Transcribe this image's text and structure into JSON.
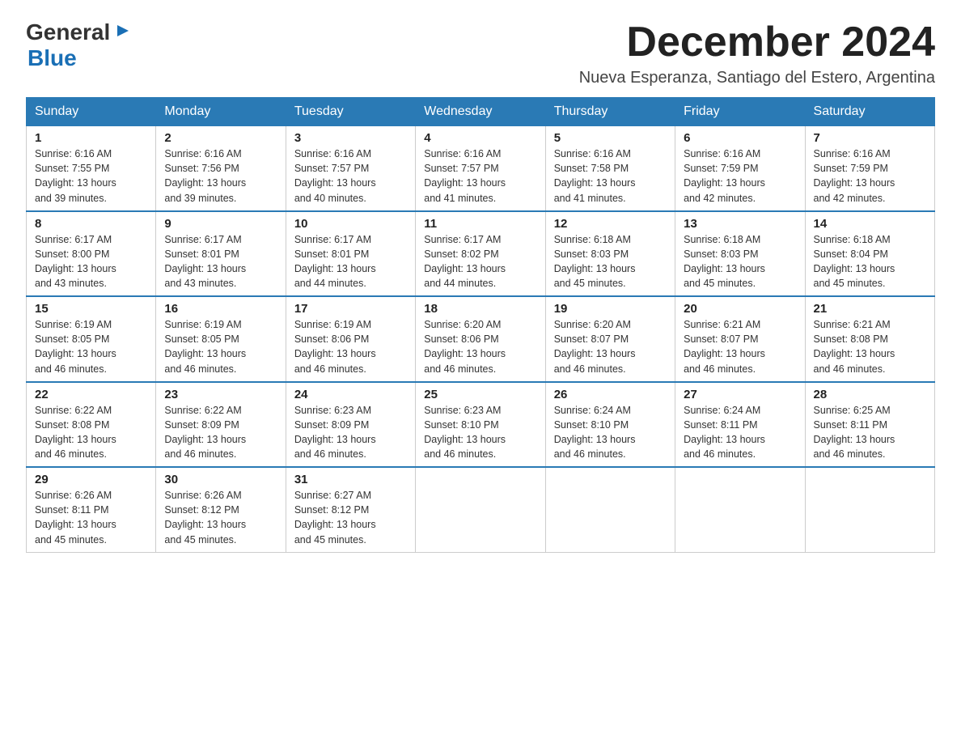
{
  "header": {
    "logo_general": "General",
    "logo_blue": "Blue",
    "month_title": "December 2024",
    "location": "Nueva Esperanza, Santiago del Estero, Argentina"
  },
  "weekdays": [
    "Sunday",
    "Monday",
    "Tuesday",
    "Wednesday",
    "Thursday",
    "Friday",
    "Saturday"
  ],
  "weeks": [
    [
      {
        "day": "1",
        "sunrise": "6:16 AM",
        "sunset": "7:55 PM",
        "daylight": "13 hours and 39 minutes."
      },
      {
        "day": "2",
        "sunrise": "6:16 AM",
        "sunset": "7:56 PM",
        "daylight": "13 hours and 39 minutes."
      },
      {
        "day": "3",
        "sunrise": "6:16 AM",
        "sunset": "7:57 PM",
        "daylight": "13 hours and 40 minutes."
      },
      {
        "day": "4",
        "sunrise": "6:16 AM",
        "sunset": "7:57 PM",
        "daylight": "13 hours and 41 minutes."
      },
      {
        "day": "5",
        "sunrise": "6:16 AM",
        "sunset": "7:58 PM",
        "daylight": "13 hours and 41 minutes."
      },
      {
        "day": "6",
        "sunrise": "6:16 AM",
        "sunset": "7:59 PM",
        "daylight": "13 hours and 42 minutes."
      },
      {
        "day": "7",
        "sunrise": "6:16 AM",
        "sunset": "7:59 PM",
        "daylight": "13 hours and 42 minutes."
      }
    ],
    [
      {
        "day": "8",
        "sunrise": "6:17 AM",
        "sunset": "8:00 PM",
        "daylight": "13 hours and 43 minutes."
      },
      {
        "day": "9",
        "sunrise": "6:17 AM",
        "sunset": "8:01 PM",
        "daylight": "13 hours and 43 minutes."
      },
      {
        "day": "10",
        "sunrise": "6:17 AM",
        "sunset": "8:01 PM",
        "daylight": "13 hours and 44 minutes."
      },
      {
        "day": "11",
        "sunrise": "6:17 AM",
        "sunset": "8:02 PM",
        "daylight": "13 hours and 44 minutes."
      },
      {
        "day": "12",
        "sunrise": "6:18 AM",
        "sunset": "8:03 PM",
        "daylight": "13 hours and 45 minutes."
      },
      {
        "day": "13",
        "sunrise": "6:18 AM",
        "sunset": "8:03 PM",
        "daylight": "13 hours and 45 minutes."
      },
      {
        "day": "14",
        "sunrise": "6:18 AM",
        "sunset": "8:04 PM",
        "daylight": "13 hours and 45 minutes."
      }
    ],
    [
      {
        "day": "15",
        "sunrise": "6:19 AM",
        "sunset": "8:05 PM",
        "daylight": "13 hours and 46 minutes."
      },
      {
        "day": "16",
        "sunrise": "6:19 AM",
        "sunset": "8:05 PM",
        "daylight": "13 hours and 46 minutes."
      },
      {
        "day": "17",
        "sunrise": "6:19 AM",
        "sunset": "8:06 PM",
        "daylight": "13 hours and 46 minutes."
      },
      {
        "day": "18",
        "sunrise": "6:20 AM",
        "sunset": "8:06 PM",
        "daylight": "13 hours and 46 minutes."
      },
      {
        "day": "19",
        "sunrise": "6:20 AM",
        "sunset": "8:07 PM",
        "daylight": "13 hours and 46 minutes."
      },
      {
        "day": "20",
        "sunrise": "6:21 AM",
        "sunset": "8:07 PM",
        "daylight": "13 hours and 46 minutes."
      },
      {
        "day": "21",
        "sunrise": "6:21 AM",
        "sunset": "8:08 PM",
        "daylight": "13 hours and 46 minutes."
      }
    ],
    [
      {
        "day": "22",
        "sunrise": "6:22 AM",
        "sunset": "8:08 PM",
        "daylight": "13 hours and 46 minutes."
      },
      {
        "day": "23",
        "sunrise": "6:22 AM",
        "sunset": "8:09 PM",
        "daylight": "13 hours and 46 minutes."
      },
      {
        "day": "24",
        "sunrise": "6:23 AM",
        "sunset": "8:09 PM",
        "daylight": "13 hours and 46 minutes."
      },
      {
        "day": "25",
        "sunrise": "6:23 AM",
        "sunset": "8:10 PM",
        "daylight": "13 hours and 46 minutes."
      },
      {
        "day": "26",
        "sunrise": "6:24 AM",
        "sunset": "8:10 PM",
        "daylight": "13 hours and 46 minutes."
      },
      {
        "day": "27",
        "sunrise": "6:24 AM",
        "sunset": "8:11 PM",
        "daylight": "13 hours and 46 minutes."
      },
      {
        "day": "28",
        "sunrise": "6:25 AM",
        "sunset": "8:11 PM",
        "daylight": "13 hours and 46 minutes."
      }
    ],
    [
      {
        "day": "29",
        "sunrise": "6:26 AM",
        "sunset": "8:11 PM",
        "daylight": "13 hours and 45 minutes."
      },
      {
        "day": "30",
        "sunrise": "6:26 AM",
        "sunset": "8:12 PM",
        "daylight": "13 hours and 45 minutes."
      },
      {
        "day": "31",
        "sunrise": "6:27 AM",
        "sunset": "8:12 PM",
        "daylight": "13 hours and 45 minutes."
      },
      null,
      null,
      null,
      null
    ]
  ],
  "labels": {
    "sunrise": "Sunrise:",
    "sunset": "Sunset:",
    "daylight": "Daylight:"
  }
}
